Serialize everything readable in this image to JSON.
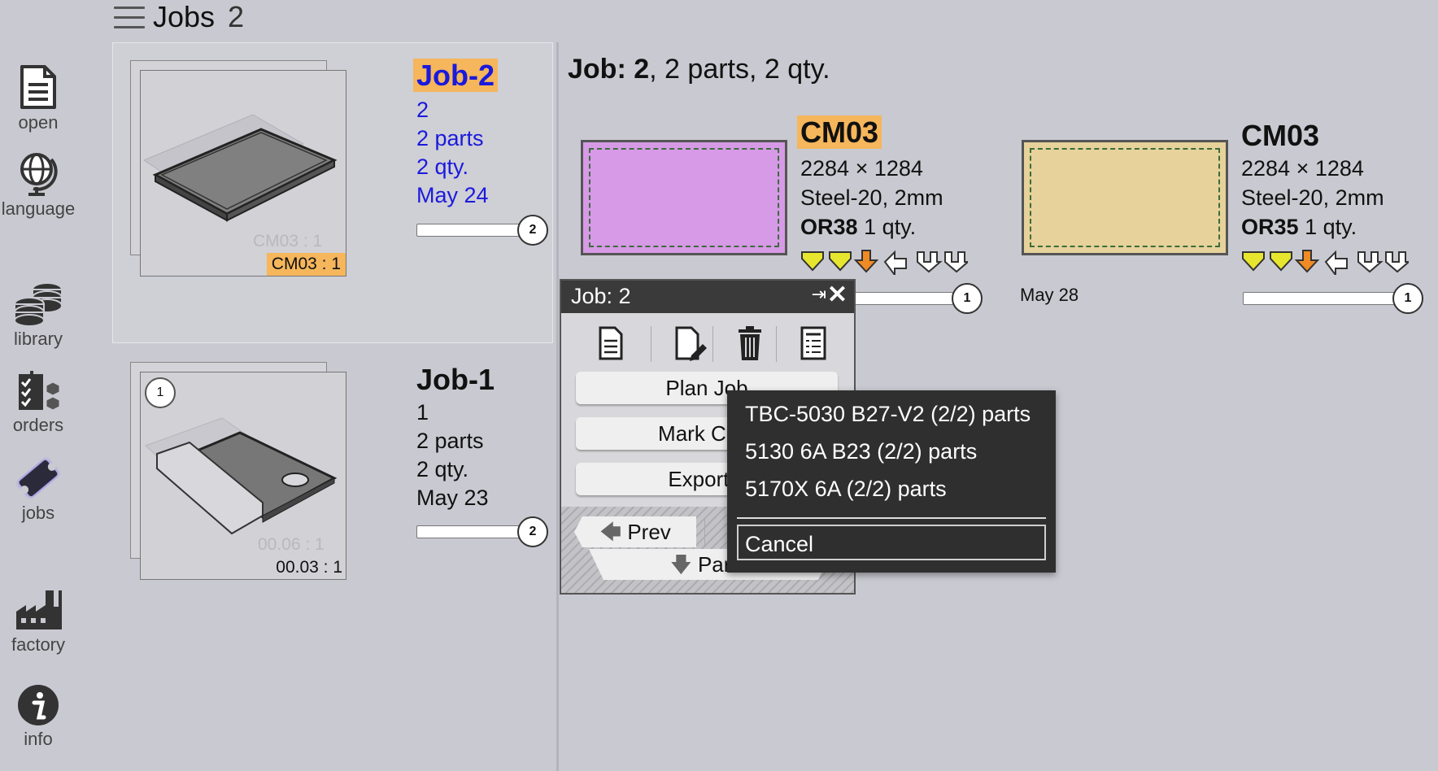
{
  "app": {
    "title": "Jobs",
    "count": "2"
  },
  "sidebar": {
    "items": [
      {
        "label": "open",
        "icon": "document-icon"
      },
      {
        "label": "language",
        "icon": "globe-icon"
      },
      {
        "label": "library",
        "icon": "coins-stack-icon"
      },
      {
        "label": "orders",
        "icon": "orders-checklist-icon"
      },
      {
        "label": "jobs",
        "icon": "ticket-icon",
        "active": true
      },
      {
        "label": "factory",
        "icon": "factory-icon"
      },
      {
        "label": "info",
        "icon": "info-icon"
      }
    ]
  },
  "jobs": [
    {
      "name": "Job-2",
      "number": "2",
      "parts": "2 parts",
      "qty": "2 qty.",
      "date": "May 24",
      "thumb_label_faint": "CM03 : 1",
      "thumb_label": "CM03 : 1",
      "progress_value": "2",
      "selected": true
    },
    {
      "name": "Job-1",
      "number": "1",
      "parts": "2 parts",
      "qty": "2 qty.",
      "date": "May 23",
      "thumb_badge": "1",
      "thumb_label_faint": "00.06 : 1",
      "thumb_label": "00.03 : 1",
      "progress_value": "2",
      "selected": false
    }
  ],
  "detail": {
    "title_prefix": "Job:",
    "title_number": "2",
    "title_rest": ", 2 parts, 2 qty.",
    "parts": [
      {
        "name": "CM03",
        "size": "2284 × 1284",
        "material": "Steel-20, 2mm",
        "order": "OR38",
        "qty": "1 qty.",
        "plate_color": "#d69ae6",
        "date": "",
        "progress_value": "1",
        "highlighted": true
      },
      {
        "name": "CM03",
        "size": "2284 × 1284",
        "material": "Steel-20, 2mm",
        "order": "OR35",
        "qty": "1 qty.",
        "plate_color": "#e6d29a",
        "date": "May 28",
        "progress_value": "1",
        "highlighted": false
      }
    ]
  },
  "popup": {
    "title": "Job: 2",
    "pin_glyph": "⇥",
    "close_glyph": "✕",
    "tools": [
      "document-icon",
      "edit-document-icon",
      "trash-icon",
      "report-icon"
    ],
    "buttons": [
      "Plan Job",
      "Mark Com",
      "Export J"
    ],
    "prev_label": "Prev",
    "parts_label": "Par"
  },
  "context_menu": {
    "items": [
      "TBC-5030 B27-V2  (2/2) parts",
      "5130 6A B23  (2/2) parts",
      "5170X 6A  (2/2) parts"
    ],
    "cancel": "Cancel"
  },
  "colors": {
    "background": "#c9c9d1",
    "highlight": "#f5b65c",
    "link_blue": "#1a1adc",
    "arrow_yellow": "#e6e62e",
    "arrow_orange": "#f08a24"
  }
}
